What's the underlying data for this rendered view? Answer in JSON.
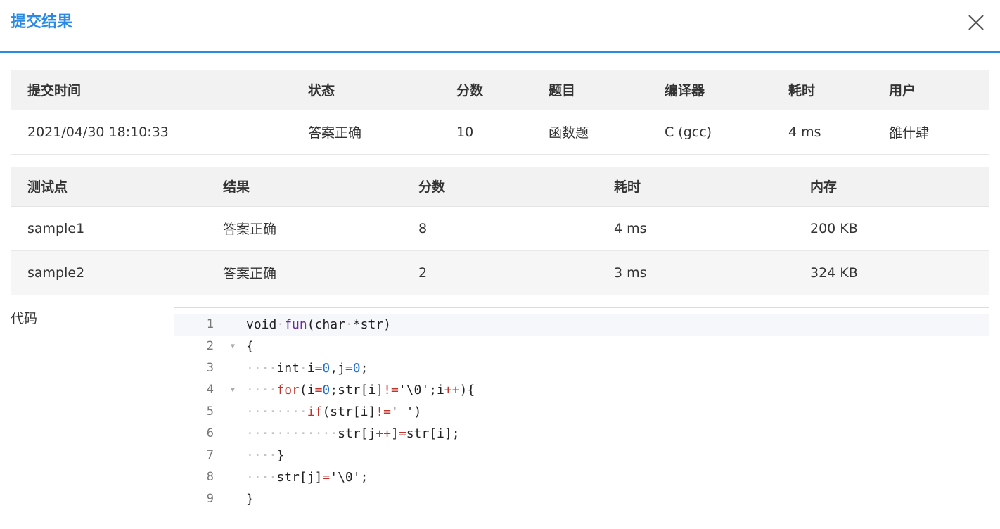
{
  "dialog": {
    "title": "提交结果",
    "close_icon": "close-icon"
  },
  "summary": {
    "headers": [
      "提交时间",
      "状态",
      "分数",
      "题目",
      "编译器",
      "耗时",
      "用户"
    ],
    "row": {
      "time": "2021/04/30 18:10:33",
      "status": "答案正确",
      "score": "10",
      "problem": "函数题",
      "compiler": "C (gcc)",
      "duration": "4 ms",
      "user": "雒什肆"
    }
  },
  "tests": {
    "headers": [
      "测试点",
      "结果",
      "分数",
      "耗时",
      "内存"
    ],
    "rows": [
      {
        "case": "sample1",
        "result": "答案正确",
        "score": "8",
        "time": "4 ms",
        "memory": "200 KB"
      },
      {
        "case": "sample2",
        "result": "答案正确",
        "score": "2",
        "time": "3 ms",
        "memory": "324 KB"
      }
    ]
  },
  "code": {
    "label": "代码",
    "line_numbers": [
      "1",
      "2",
      "3",
      "4",
      "5",
      "6",
      "7",
      "8",
      "9"
    ],
    "fold_marker": "▼",
    "lines": [
      "void fun(char *str)",
      "{",
      "    int i=0,j=0;",
      "    for(i=0;str[i]!='\\0';i++){",
      "        if(str[i]!=' ')",
      "            str[j++]=str[i];",
      "    }",
      "    str[j]='\\0';",
      "}"
    ]
  },
  "colors": {
    "accent": "#2a8ae6",
    "status_ok": "#e24b3b",
    "header_bg": "#f2f2f2"
  }
}
